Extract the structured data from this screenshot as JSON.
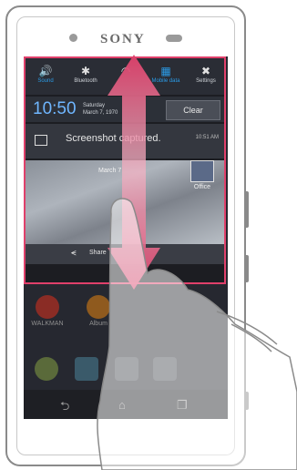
{
  "phone": {
    "brand": "SONY"
  },
  "quick_settings": [
    {
      "label": "Sound",
      "glyph": "🔊",
      "icon": "sound-icon",
      "active": true
    },
    {
      "label": "Bluetooth",
      "glyph": "B",
      "icon": "bluetooth-icon",
      "active": false
    },
    {
      "label": "",
      "glyph": "≡",
      "icon": "wifi-icon",
      "active": false
    },
    {
      "label": "Mobile data",
      "glyph": "▦",
      "icon": "mobile-data-icon",
      "active": true
    },
    {
      "label": "Settings",
      "glyph": "✖",
      "icon": "settings-icon",
      "active": false
    }
  ],
  "clock": {
    "time": "10:50",
    "day": "Saturday",
    "date": "March 7, 1970"
  },
  "clear_button": "Clear",
  "notification": {
    "title": "Screenshot captured.",
    "time": "10:51 AM"
  },
  "screenshot_preview": {
    "date_text": "March 7",
    "office_label": "Office"
  },
  "share_label": "Share",
  "home_apps": [
    {
      "label": "WALKMAN",
      "color": "#d24a3a"
    },
    {
      "label": "Album",
      "color": "#e08a2a"
    }
  ],
  "accent_colors": {
    "highlight": "#e0406b",
    "clock": "#6fb6ff"
  }
}
